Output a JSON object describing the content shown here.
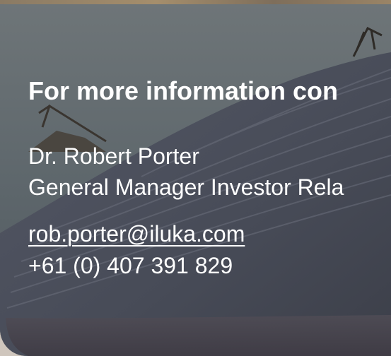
{
  "contact": {
    "heading": "For more information con",
    "name": "Dr. Robert Porter",
    "role": "General Manager Investor Rela",
    "email": "rob.porter@iluka.com",
    "phone": "+61 (0) 407 391 829"
  },
  "colors": {
    "text": "#ffffff",
    "sky": "#5a6469",
    "dune": "#4b4f5a"
  }
}
